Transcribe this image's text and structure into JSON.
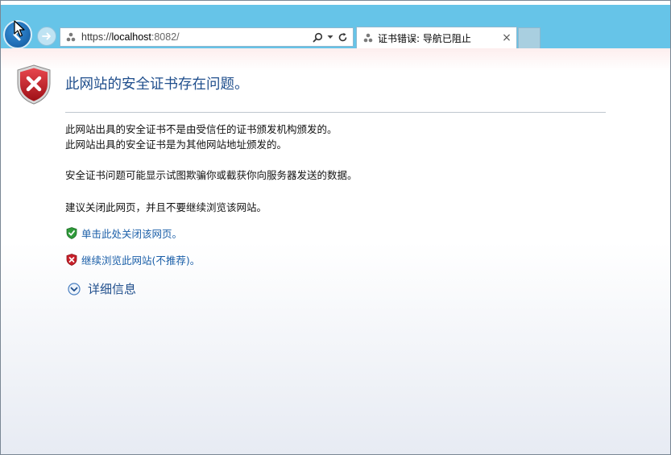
{
  "browser": {
    "address": {
      "scheme": "https://",
      "host": "localhost",
      "port_path": ":8082/"
    },
    "tab": {
      "title": "证书错误: 导航已阻止",
      "close_glyph": "×"
    }
  },
  "page": {
    "title": "此网站的安全证书存在问题。",
    "paragraph1": [
      "此网站出具的安全证书不是由受信任的证书颁发机构颁发的。",
      "此网站出具的安全证书是为其他网站地址颁发的。"
    ],
    "paragraph2": "安全证书问题可能显示试图欺骗你或截获你向服务器发送的数据。",
    "paragraph3": "建议关闭此网页，并且不要继续浏览该网站。",
    "actions": {
      "close_page": "单击此处关闭该网页。",
      "continue": "继续浏览此网站(不推荐)。"
    },
    "details_label": "详细信息"
  },
  "colors": {
    "chrome": "#66c4e8",
    "title": "#1f4e8c",
    "link": "#1a5ea8",
    "error_red": "#c8202a",
    "safe_green": "#2f9a3a"
  },
  "icons": {
    "back": "back-arrow-icon",
    "forward": "forward-arrow-icon",
    "site": "certificate-error-icon",
    "search": "search-icon",
    "dropdown": "dropdown-arrow-icon",
    "refresh": "refresh-icon",
    "error_shield": "error-shield-icon",
    "green_shield": "green-shield-icon",
    "red_shield": "red-shield-icon",
    "expand": "expand-circle-icon"
  }
}
